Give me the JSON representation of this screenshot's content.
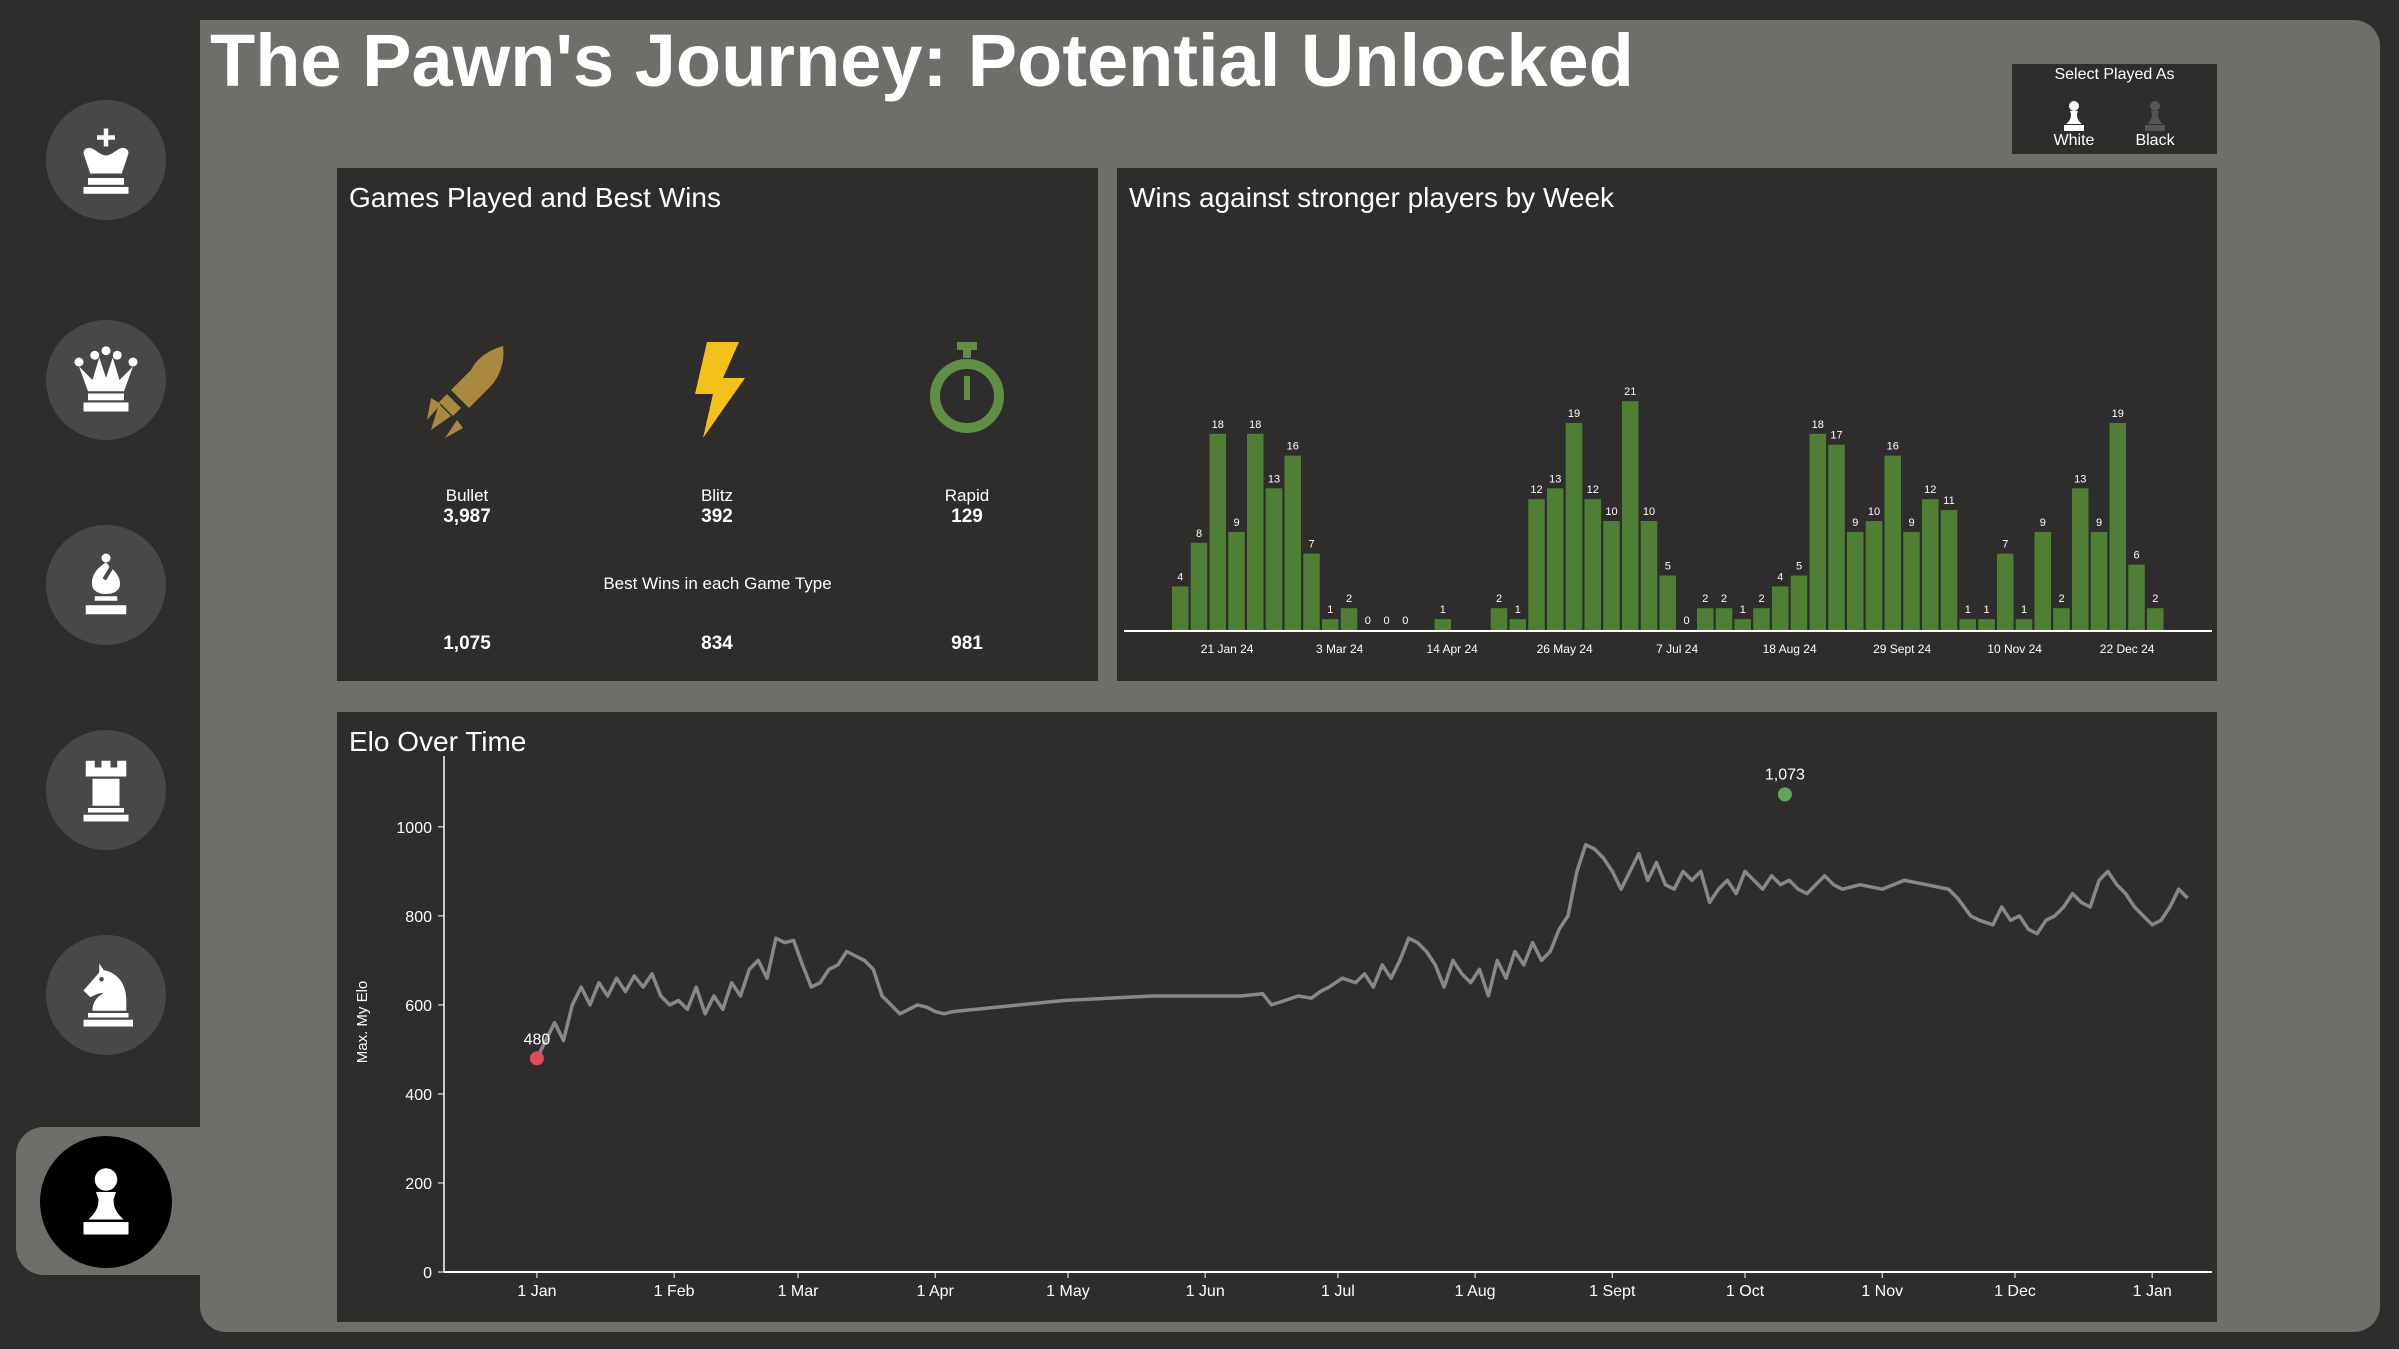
{
  "title": "The Pawn's Journey: Potential Unlocked",
  "sidebar": {
    "items": [
      {
        "name": "king",
        "icon": "king-icon"
      },
      {
        "name": "queen",
        "icon": "queen-icon"
      },
      {
        "name": "bishop",
        "icon": "bishop-icon"
      },
      {
        "name": "rook",
        "icon": "rook-icon"
      },
      {
        "name": "knight",
        "icon": "knight-icon"
      },
      {
        "name": "pawn",
        "icon": "pawn-icon",
        "active": true
      }
    ]
  },
  "filter": {
    "title": "Select Played As",
    "options": [
      {
        "label": "White",
        "selected": true
      },
      {
        "label": "Black",
        "selected": false
      }
    ]
  },
  "games": {
    "title": "Games Played and Best Wins",
    "best_label": "Best Wins in each Game Type",
    "types": [
      {
        "label": "Bullet",
        "count": "3,987",
        "best": "1,075",
        "icon": "rocket-icon",
        "color": "#a9883f"
      },
      {
        "label": "Blitz",
        "count": "392",
        "best": "834",
        "icon": "lightning-icon",
        "color": "#f2c21b"
      },
      {
        "label": "Rapid",
        "count": "129",
        "best": "981",
        "icon": "stopwatch-icon",
        "color": "#5e8f44"
      }
    ]
  },
  "colors": {
    "bar": "#4e7f35",
    "line": "#8a8886",
    "min_point": "#e04b55",
    "max_point": "#5fa55a"
  },
  "chart_data": [
    {
      "type": "bar",
      "title": "Wins against stronger players by Week",
      "values": [
        4,
        8,
        18,
        9,
        18,
        13,
        16,
        7,
        1,
        2,
        0,
        0,
        0,
        null,
        1,
        null,
        null,
        2,
        1,
        12,
        13,
        19,
        12,
        10,
        21,
        10,
        5,
        0,
        2,
        2,
        1,
        2,
        4,
        5,
        18,
        17,
        9,
        10,
        16,
        9,
        12,
        11,
        1,
        1,
        7,
        1,
        9,
        2,
        13,
        9,
        19,
        6,
        2
      ],
      "tick_labels": [
        "21 Jan 24",
        "3 Mar 24",
        "14 Apr 24",
        "26 May 24",
        "7 Jul 24",
        "18 Aug 24",
        "29 Sept 24",
        "10 Nov 24",
        "22 Dec 24"
      ],
      "tick_index": [
        2.5,
        8.5,
        14.5,
        20.5,
        26.5,
        32.5,
        38.5,
        44.5,
        50.5
      ]
    },
    {
      "type": "line",
      "title": "Elo Over Time",
      "ylabel": "Max. My Elo",
      "ylim": [
        0,
        1130
      ],
      "yticks": [
        0,
        200,
        400,
        600,
        800,
        1000
      ],
      "xticks": [
        "1 Jan",
        "1 Feb",
        "1 Mar",
        "1 Apr",
        "1 May",
        "1 Jun",
        "1 Jul",
        "1 Aug",
        "1 Sept",
        "1 Oct",
        "1 Nov",
        "1 Dec",
        "1 Jan"
      ],
      "xlim_days": [
        -20,
        375
      ],
      "min": {
        "day": 1,
        "value": 480,
        "label": "480"
      },
      "max": {
        "day": 283,
        "value": 1073,
        "label": "1,073"
      },
      "points": [
        [
          1,
          480
        ],
        [
          5,
          560
        ],
        [
          7,
          520
        ],
        [
          9,
          600
        ],
        [
          11,
          640
        ],
        [
          13,
          600
        ],
        [
          15,
          650
        ],
        [
          17,
          620
        ],
        [
          19,
          660
        ],
        [
          21,
          630
        ],
        [
          23,
          665
        ],
        [
          25,
          640
        ],
        [
          27,
          670
        ],
        [
          29,
          620
        ],
        [
          31,
          600
        ],
        [
          33,
          610
        ],
        [
          35,
          590
        ],
        [
          37,
          640
        ],
        [
          39,
          580
        ],
        [
          41,
          620
        ],
        [
          43,
          590
        ],
        [
          45,
          650
        ],
        [
          47,
          620
        ],
        [
          49,
          680
        ],
        [
          51,
          700
        ],
        [
          53,
          660
        ],
        [
          55,
          750
        ],
        [
          57,
          740
        ],
        [
          59,
          745
        ],
        [
          61,
          690
        ],
        [
          63,
          640
        ],
        [
          65,
          650
        ],
        [
          67,
          680
        ],
        [
          69,
          690
        ],
        [
          71,
          720
        ],
        [
          73,
          710
        ],
        [
          75,
          700
        ],
        [
          77,
          680
        ],
        [
          79,
          620
        ],
        [
          81,
          600
        ],
        [
          83,
          580
        ],
        [
          85,
          590
        ],
        [
          87,
          600
        ],
        [
          89,
          595
        ],
        [
          91,
          585
        ],
        [
          93,
          580
        ],
        [
          95,
          585
        ],
        [
          100,
          590
        ],
        [
          110,
          600
        ],
        [
          120,
          610
        ],
        [
          130,
          615
        ],
        [
          140,
          620
        ],
        [
          150,
          620
        ],
        [
          160,
          620
        ],
        [
          165,
          625
        ],
        [
          167,
          600
        ],
        [
          170,
          610
        ],
        [
          173,
          620
        ],
        [
          176,
          615
        ],
        [
          178,
          630
        ],
        [
          180,
          640
        ],
        [
          183,
          660
        ],
        [
          186,
          650
        ],
        [
          188,
          670
        ],
        [
          190,
          640
        ],
        [
          192,
          690
        ],
        [
          194,
          660
        ],
        [
          196,
          700
        ],
        [
          198,
          750
        ],
        [
          200,
          740
        ],
        [
          202,
          720
        ],
        [
          204,
          690
        ],
        [
          206,
          640
        ],
        [
          208,
          700
        ],
        [
          210,
          670
        ],
        [
          212,
          650
        ],
        [
          214,
          680
        ],
        [
          216,
          620
        ],
        [
          218,
          700
        ],
        [
          220,
          660
        ],
        [
          222,
          720
        ],
        [
          224,
          690
        ],
        [
          226,
          740
        ],
        [
          228,
          700
        ],
        [
          230,
          720
        ],
        [
          232,
          770
        ],
        [
          234,
          800
        ],
        [
          236,
          900
        ],
        [
          238,
          960
        ],
        [
          240,
          950
        ],
        [
          242,
          930
        ],
        [
          244,
          900
        ],
        [
          246,
          860
        ],
        [
          248,
          900
        ],
        [
          250,
          940
        ],
        [
          252,
          880
        ],
        [
          254,
          920
        ],
        [
          256,
          870
        ],
        [
          258,
          860
        ],
        [
          260,
          900
        ],
        [
          262,
          880
        ],
        [
          264,
          900
        ],
        [
          266,
          830
        ],
        [
          268,
          860
        ],
        [
          270,
          880
        ],
        [
          272,
          850
        ],
        [
          274,
          900
        ],
        [
          276,
          880
        ],
        [
          278,
          860
        ],
        [
          280,
          890
        ],
        [
          282,
          870
        ],
        [
          284,
          880
        ],
        [
          286,
          860
        ],
        [
          288,
          850
        ],
        [
          290,
          870
        ],
        [
          292,
          890
        ],
        [
          294,
          870
        ],
        [
          296,
          860
        ],
        [
          300,
          870
        ],
        [
          305,
          860
        ],
        [
          310,
          880
        ],
        [
          315,
          870
        ],
        [
          320,
          860
        ],
        [
          322,
          840
        ],
        [
          325,
          800
        ],
        [
          327,
          790
        ],
        [
          330,
          780
        ],
        [
          332,
          820
        ],
        [
          334,
          790
        ],
        [
          336,
          800
        ],
        [
          338,
          770
        ],
        [
          340,
          760
        ],
        [
          342,
          790
        ],
        [
          344,
          800
        ],
        [
          346,
          820
        ],
        [
          348,
          850
        ],
        [
          350,
          830
        ],
        [
          352,
          820
        ],
        [
          354,
          880
        ],
        [
          356,
          900
        ],
        [
          358,
          870
        ],
        [
          360,
          850
        ],
        [
          362,
          820
        ],
        [
          364,
          800
        ],
        [
          366,
          780
        ],
        [
          368,
          790
        ],
        [
          370,
          820
        ],
        [
          372,
          860
        ],
        [
          374,
          840
        ]
      ]
    }
  ],
  "bar_panel_labels": {
    "zero": "0"
  }
}
